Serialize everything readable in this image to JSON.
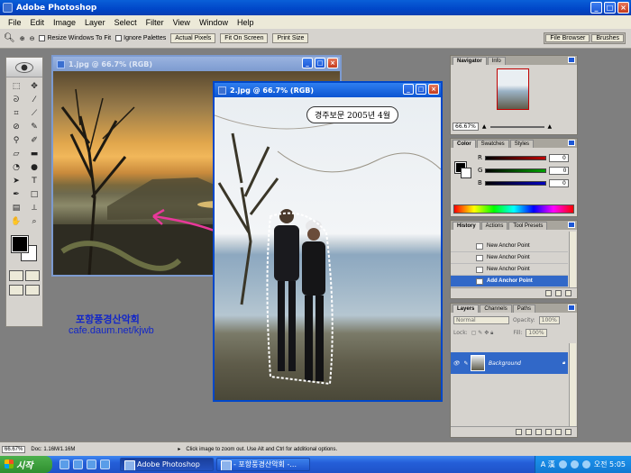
{
  "app": {
    "title": "Adobe Photoshop"
  },
  "menu": [
    "File",
    "Edit",
    "Image",
    "Layer",
    "Select",
    "Filter",
    "View",
    "Window",
    "Help"
  ],
  "options": {
    "resize_windows": "Resize Windows To Fit",
    "ignore_palettes": "Ignore Palettes",
    "actual_pixels": "Actual Pixels",
    "fit_on_screen": "Fit On Screen",
    "print_size": "Print Size",
    "file_browser": "File Browser",
    "brushes": "Brushes"
  },
  "doc1": {
    "title": "1.jpg @ 66.7% (RGB)"
  },
  "doc2": {
    "title": "2.jpg @ 66.7% (RGB)",
    "caption": "경주보문 2005년 4월"
  },
  "watermark": {
    "line1": "포항풍경산악회",
    "line2": "cafe.daum.net/kjwb"
  },
  "navigator": {
    "tabs": [
      "Navigator",
      "Info"
    ],
    "zoom": "66.67%"
  },
  "color": {
    "tabs": [
      "Color",
      "Swatches",
      "Styles"
    ],
    "channels": [
      {
        "label": "R",
        "value": "0",
        "color": "#c00000"
      },
      {
        "label": "G",
        "value": "0",
        "color": "#00a000"
      },
      {
        "label": "B",
        "value": "0",
        "color": "#0000c0"
      }
    ]
  },
  "history": {
    "tabs": [
      "History",
      "Actions",
      "Tool Presets"
    ],
    "items": [
      "New Anchor Point",
      "New Anchor Point",
      "New Anchor Point",
      "Add Anchor Point"
    ]
  },
  "layers": {
    "tabs": [
      "Layers",
      "Channels",
      "Paths"
    ],
    "blend": "Normal",
    "opacity_label": "Opacity:",
    "opacity": "100%",
    "lock_label": "Lock:",
    "fill_label": "Fill:",
    "fill": "100%",
    "layer_name": "Background"
  },
  "status": {
    "zoom": "66.67%",
    "doc": "Doc: 1.16M/1.16M",
    "hint": "Click image to zoom out. Use Alt and Ctrl for additional options."
  },
  "taskbar": {
    "start": "시작",
    "items": [
      "Adobe Photoshop",
      "- 포항풍경산악회 -..."
    ],
    "tray_ime": "A 漢",
    "clock": "오전 5:05"
  }
}
